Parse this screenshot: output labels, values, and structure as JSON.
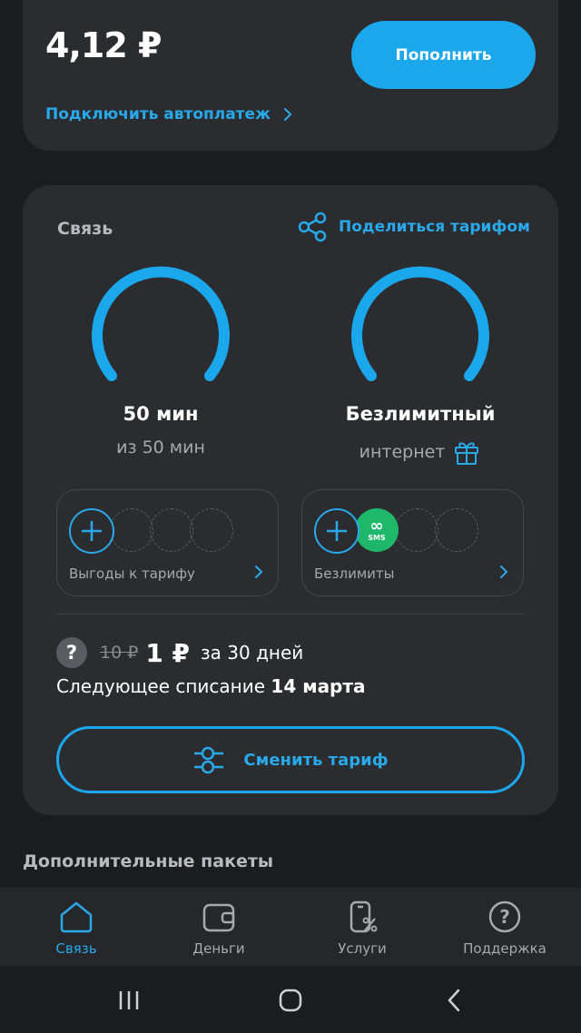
{
  "balance": {
    "amount": "4,12 ₽",
    "topup_label": "Пополнить",
    "autopay_label": "Подключить автоплатеж"
  },
  "tariff": {
    "title": "Связь",
    "share_label": "Поделиться тарифом",
    "minutes": {
      "value": "50 мин",
      "sub": "из 50 мин",
      "remaining_fraction": 1.0
    },
    "internet": {
      "value": "Безлимитный",
      "sub": "интернет",
      "remaining_fraction": 1.0
    },
    "perks_left": {
      "label": "Выгоды к тарифу"
    },
    "perks_right": {
      "label": "Безлимиты",
      "badge_symbol": "∞",
      "badge_text": "SMS"
    },
    "help_symbol": "?",
    "old_price": "10 ₽",
    "new_price": "1 ₽",
    "period": "за 30 дней",
    "next_charge_prefix": "Следующее списание ",
    "next_charge_date": "14 марта",
    "change_label": "Сменить тариф"
  },
  "extra_title": "Дополнительные пакеты",
  "tabs": [
    {
      "label": "Связь",
      "icon": "home-icon",
      "active": true
    },
    {
      "label": "Деньги",
      "icon": "wallet-icon",
      "active": false
    },
    {
      "label": "Услуги",
      "icon": "services-icon",
      "active": false
    },
    {
      "label": "Поддержка",
      "icon": "help-icon",
      "active": false
    }
  ],
  "colors": {
    "accent": "#1aa7ec",
    "card": "#2b2c30",
    "background": "#1b1c1f",
    "sms_badge": "#1fb86a"
  }
}
